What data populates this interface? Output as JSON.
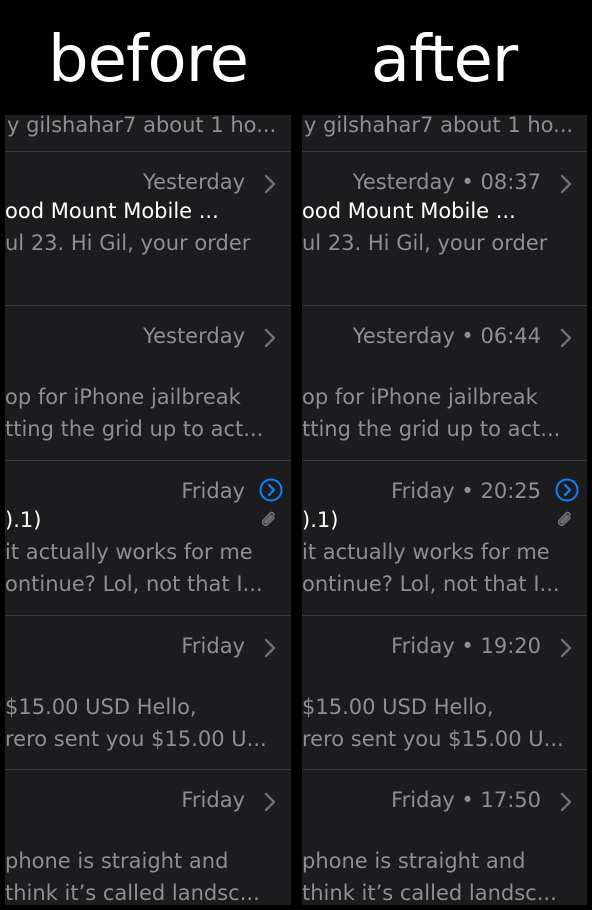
{
  "headings": {
    "before": "before",
    "after": "after"
  },
  "colors": {
    "background": "#000000",
    "list_background": "#1c1c1e",
    "secondary_text": "#8e8e93",
    "primary_text": "#ffffff",
    "accent": "#0a84ff",
    "separator": "#38383a"
  },
  "before": {
    "top_line": "y gilshahar7 about 1 ho...",
    "rows": [
      {
        "time": "Yesterday",
        "line1": "ood Mount Mobile ...",
        "line2": "ul 23. Hi Gil, your order",
        "line3": "",
        "chevron": "chevron-right-icon",
        "attachment": false
      },
      {
        "time": "Yesterday",
        "line1": "",
        "line2": "op for iPhone jailbreak",
        "line3": "tting the grid up to act...",
        "chevron": "chevron-right-icon",
        "attachment": false
      },
      {
        "time": "Friday",
        "line1": ").1)",
        "line2": " it actually works for me",
        "line3": "ontinue? Lol, not that I...",
        "chevron": "chevron-circle-icon",
        "attachment": true
      },
      {
        "time": "Friday",
        "line1": "",
        "line2": " $15.00 USD Hello,",
        "line3": "rero sent you $15.00 U...",
        "chevron": "chevron-right-icon",
        "attachment": false
      },
      {
        "time": "Friday",
        "line1": "",
        "line2": " phone is straight and",
        "line3": "think it’s called landsc...",
        "chevron": "chevron-right-icon",
        "attachment": false
      }
    ]
  },
  "after": {
    "top_line": "y gilshahar7 about 1 ho...",
    "rows": [
      {
        "time": "Yesterday • 08:37",
        "line1": "ood Mount Mobile ...",
        "line2": "ul 23. Hi Gil, your order",
        "line3": "",
        "chevron": "chevron-right-icon",
        "attachment": false
      },
      {
        "time": "Yesterday • 06:44",
        "line1": "",
        "line2": "op for iPhone jailbreak",
        "line3": "tting the grid up to act...",
        "chevron": "chevron-right-icon",
        "attachment": false
      },
      {
        "time": "Friday • 20:25",
        "line1": ").1)",
        "line2": " it actually works for me",
        "line3": "ontinue? Lol, not that I...",
        "chevron": "chevron-circle-icon",
        "attachment": true
      },
      {
        "time": "Friday • 19:20",
        "line1": "",
        "line2": " $15.00 USD Hello,",
        "line3": "rero sent you $15.00 U...",
        "chevron": "chevron-right-icon",
        "attachment": false
      },
      {
        "time": "Friday • 17:50",
        "line1": "",
        "line2": " phone is straight and",
        "line3": "think it’s called landsc...",
        "chevron": "chevron-right-icon",
        "attachment": false
      }
    ]
  }
}
